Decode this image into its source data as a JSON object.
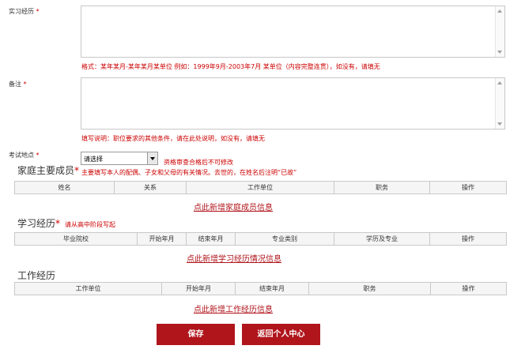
{
  "internship": {
    "label": "实习经历",
    "star": "*",
    "value": "",
    "hint": "格式：某年某月-某年某月某单位 例如：1999年9月-2003年7月 某单位（内容完整连贯），如没有，请填无"
  },
  "remarks": {
    "label": "备注",
    "star": "*",
    "value": "",
    "hint": "填写说明：职位要求的其他条件，请在此处说明，如没有，请填无"
  },
  "exam_location": {
    "label": "考试地点",
    "star": "*",
    "selected": "请选择",
    "note": "资格审查合格后不可修改"
  },
  "family": {
    "title": "家庭主要成员",
    "star": "*",
    "hint": "主要填写本人的配偶、子女和父母的有关情况。去世的，在姓名后注明“已故”",
    "columns": [
      "姓名",
      "关系",
      "工作单位",
      "职务",
      "操作"
    ],
    "add_link": "点此新增家庭成员信息"
  },
  "education": {
    "title": "学习经历",
    "star": "*",
    "hint": "请从高中阶段写起",
    "columns": [
      "毕业院校",
      "开始年月",
      "结束年月",
      "专业类别",
      "学历及专业",
      "操作"
    ],
    "add_link": "点此新增学习经历情况信息"
  },
  "work": {
    "title": "工作经历",
    "columns": [
      "工作单位",
      "开始年月",
      "结束年月",
      "职务",
      "操作"
    ],
    "add_link": "点此新增工作经历信息"
  },
  "buttons": {
    "save": "保存",
    "back": "返回个人中心"
  },
  "colors": {
    "accent": "#b0151c",
    "required": "#cc0000"
  }
}
